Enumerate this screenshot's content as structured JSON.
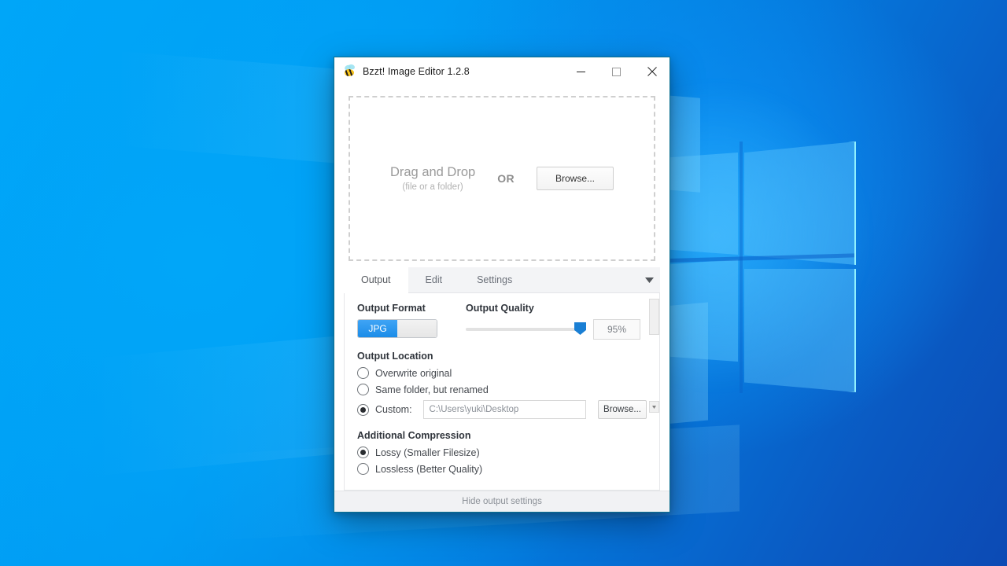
{
  "window": {
    "title": "Bzzt! Image Editor 1.2.8",
    "icon": "bee-icon",
    "controls": {
      "minimize": "minimize-icon",
      "maximize": "maximize-icon",
      "close": "close-icon"
    },
    "border_color": "#0a6f8f"
  },
  "dropzone": {
    "main_text": "Drag and Drop",
    "sub_text": "(file or a folder)",
    "or_text": "OR",
    "browse_label": "Browse..."
  },
  "tabs": [
    {
      "label": "Output",
      "active": true
    },
    {
      "label": "Edit",
      "active": false
    },
    {
      "label": "Settings",
      "active": false
    }
  ],
  "tab_caret": "chevron-down-icon",
  "output": {
    "format": {
      "title": "Output Format",
      "selected": "JPG",
      "options": [
        "JPG",
        ""
      ],
      "accent_color": "#1b8ce8"
    },
    "quality": {
      "title": "Output Quality",
      "value": "95%",
      "percent": 95
    },
    "location": {
      "title": "Output Location",
      "options": [
        {
          "label": "Overwrite original",
          "selected": false
        },
        {
          "label": "Same folder, but renamed",
          "selected": false
        },
        {
          "label": "Custom:",
          "selected": true
        }
      ],
      "custom_path": "C:\\Users\\yuki\\Desktop",
      "browse_label": "Browse..."
    },
    "compression": {
      "title": "Additional Compression",
      "options": [
        {
          "label": "Lossy (Smaller Filesize)",
          "selected": true
        },
        {
          "label": "Lossless (Better Quality)",
          "selected": false
        }
      ]
    }
  },
  "statusbar": {
    "label": "Hide output settings"
  },
  "desktop": {
    "wallpaper": "windows-10-hero-logo",
    "background_color": "#0096f0"
  }
}
